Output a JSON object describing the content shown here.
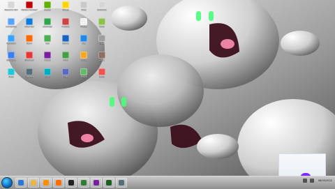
{
  "desktop": {
    "icons": [
      {
        "label": "Recycle Bin",
        "color": "#d7d7d7"
      },
      {
        "label": "Adobe Reader",
        "color": "#c00000"
      },
      {
        "label": "Media",
        "color": "#5fb000"
      },
      {
        "label": "Notes",
        "color": "#ffd400"
      },
      {
        "label": "Files",
        "color": "#c9c9c9"
      },
      {
        "label": "Shortcut",
        "color": "#d6d6d6"
      },
      {
        "label": "Computer",
        "color": "#5aa2ff"
      },
      {
        "label": "Internet",
        "color": "#0d7bdc"
      },
      {
        "label": "Settings",
        "color": "#2fa64b"
      },
      {
        "label": "Photos",
        "color": "#cf4242"
      },
      {
        "label": "Player",
        "color": "#f0f0f0"
      },
      {
        "label": "Tools",
        "color": "#8bc34a"
      },
      {
        "label": "Network",
        "color": "#39a3ff"
      },
      {
        "label": "Store",
        "color": "#ff6a00"
      },
      {
        "label": "App",
        "color": "#4caf50"
      },
      {
        "label": "Game",
        "color": "#1565c0"
      },
      {
        "label": "Mail",
        "color": "#1e88e5"
      },
      {
        "label": "Calc",
        "color": "#9e9e9e"
      },
      {
        "label": "Security",
        "color": "#3d7ff2"
      },
      {
        "label": "Browser",
        "color": "#e53935"
      },
      {
        "label": "Video",
        "color": "#7b1fa2"
      },
      {
        "label": "Paint",
        "color": "#43a047"
      },
      {
        "label": "Music",
        "color": "#f9a825"
      },
      {
        "label": "Docs",
        "color": "#8d6e63"
      },
      {
        "label": "Help",
        "color": "#26c6da"
      },
      {
        "label": "Camera",
        "color": "#546e7a"
      },
      {
        "label": "Sync",
        "color": "#00acc1"
      },
      {
        "label": "Chat",
        "color": "#5c6bc0"
      },
      {
        "label": "Maps",
        "color": "#66bb6a"
      },
      {
        "label": "News",
        "color": "#ef5350"
      }
    ]
  },
  "taskbar": {
    "pinned": [
      {
        "name": "ie-icon",
        "color": "#2a77d6"
      },
      {
        "name": "folder-icon",
        "color": "#e8b647"
      },
      {
        "name": "media-icon",
        "color": "#ff8f00"
      },
      {
        "name": "firefox-icon",
        "color": "#ff6d00"
      },
      {
        "name": "cmd-icon",
        "color": "#222222"
      },
      {
        "name": "photos-icon",
        "color": "#2e7d32"
      },
      {
        "name": "paint-icon",
        "color": "#7b1fa2"
      },
      {
        "name": "camtasia-icon",
        "color": "#1b5e20"
      },
      {
        "name": "recorder-icon",
        "color": "#546e7a"
      }
    ],
    "clock": {
      "time": "",
      "date": "06/05/2022"
    }
  }
}
